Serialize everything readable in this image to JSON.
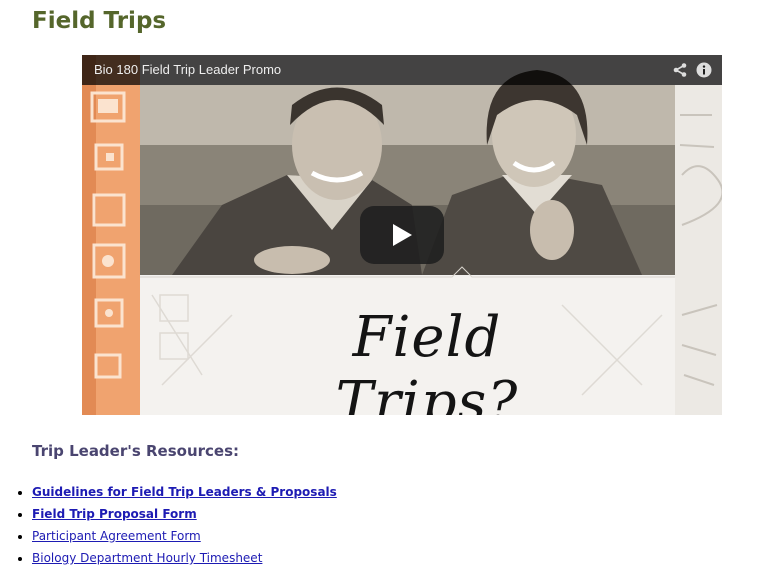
{
  "page": {
    "title": "Field Trips"
  },
  "video": {
    "title": "Bio 180 Field Trip Leader Promo",
    "overlay_text": "Field Trips?",
    "icons": [
      "share-icon",
      "info-icon",
      "play-icon"
    ],
    "colors": {
      "topbar": "#000000",
      "play_button": "#1f1f1f",
      "frame_orange": "#e9935e"
    }
  },
  "resources": {
    "heading": "Trip Leader's Resources:",
    "items": [
      {
        "label": "Guidelines for Field Trip Leaders & Proposals",
        "bold": true
      },
      {
        "label": "Field Trip Proposal Form",
        "bold": true
      },
      {
        "label": "Participant Agreement Form",
        "bold": false
      },
      {
        "label": "Biology Department Hourly Timesheet",
        "bold": false
      }
    ]
  },
  "colors": {
    "title": "#55662b",
    "heading": "#4a4570",
    "link": "#1d1bb3"
  }
}
